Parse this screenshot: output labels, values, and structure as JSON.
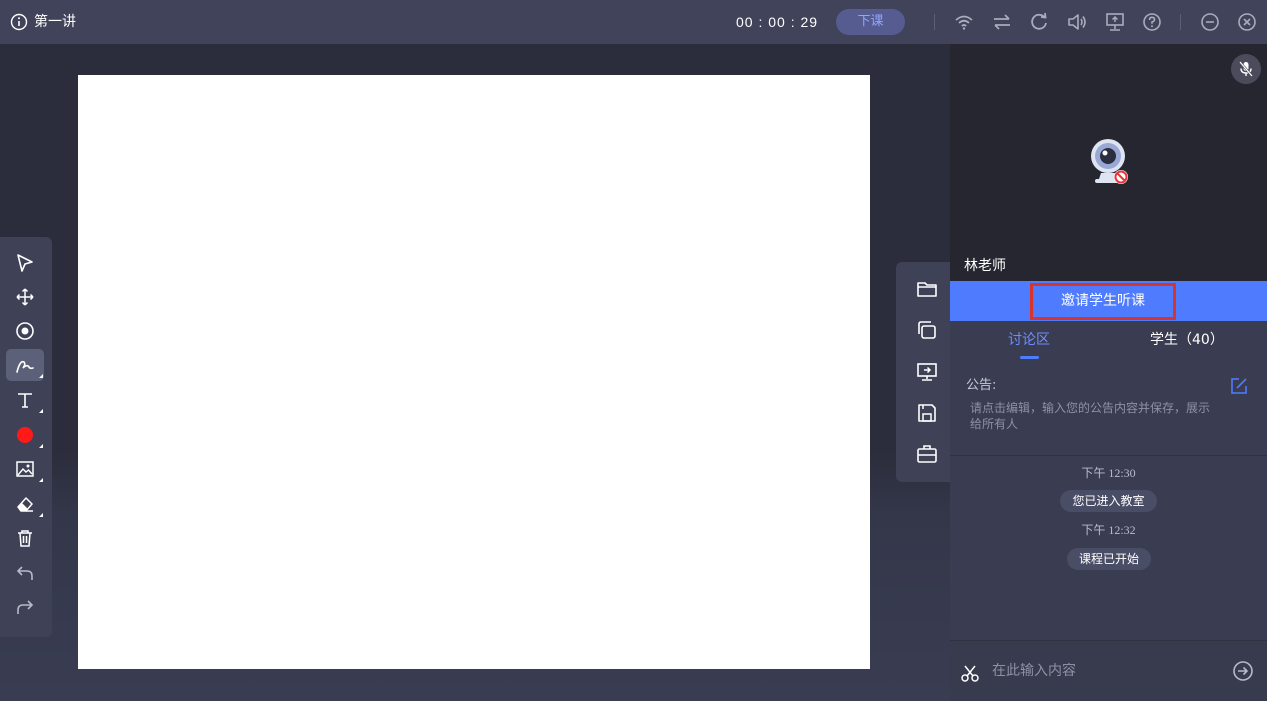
{
  "header": {
    "title": "第一讲",
    "timer": "00 : 00 : 29",
    "end_class_label": "下课"
  },
  "header_icons": [
    "info-icon",
    "wifi-icon",
    "switch-icon",
    "refresh-icon",
    "volume-icon",
    "screen-share-icon",
    "help-icon",
    "minimize-icon",
    "close-icon"
  ],
  "left_tools": [
    "select-tool",
    "move-tool",
    "laser-pointer-tool",
    "pen-tool",
    "text-tool",
    "color-tool",
    "image-tool",
    "eraser-tool",
    "delete-tool",
    "undo-tool",
    "redo-tool"
  ],
  "left_tools_active": "pen-tool",
  "pen_color": "#ff1a1a",
  "right_tools": [
    "folder-icon",
    "copy-pages-icon",
    "present-icon",
    "save-icon",
    "toolbox-icon"
  ],
  "video": {
    "teacher_name": "林老师"
  },
  "invite": {
    "label": "邀请学生听课"
  },
  "tabs": {
    "discussion": "讨论区",
    "students": "学生（40）"
  },
  "notice": {
    "title": "公告:",
    "text": "请点击编辑，输入您的公告内容并保存，展示给所有人"
  },
  "messages": [
    {
      "time": "下午 12:30",
      "text": "您已进入教室"
    },
    {
      "time": "下午 12:32",
      "text": "课程已开始"
    }
  ],
  "chat": {
    "placeholder": "在此输入内容"
  },
  "colors": {
    "accent": "#4f7cff",
    "highlight_border": "#d6342c"
  }
}
